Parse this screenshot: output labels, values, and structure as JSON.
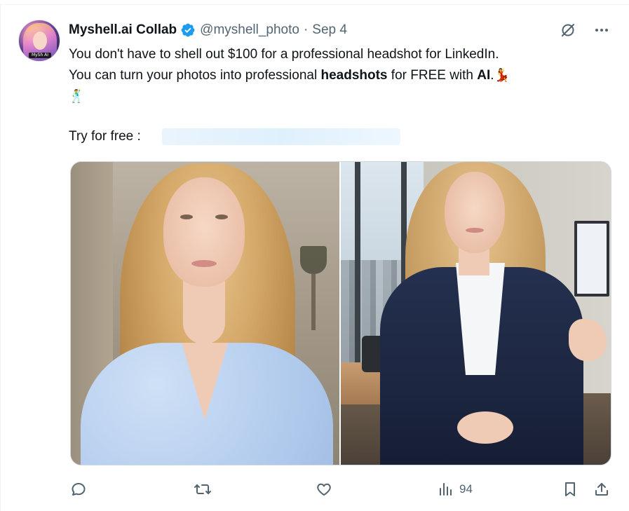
{
  "tweet": {
    "display_name": "Myshell.ai Collab",
    "handle": "@myshell_photo",
    "separator": "·",
    "date": "Sep 4",
    "avatar_label": "MySh AI",
    "text_line1": "You don't have to shell out $100 for a professional headshot for LinkedIn.",
    "text_line2_a": "You can turn your photos into professional ",
    "text_line2_b": "headshots",
    "text_line2_c": " for FREE with ",
    "text_line2_d": "AI",
    "text_line2_e": ".",
    "emoji_1": "💃",
    "emoji_2": "🕺",
    "try_label": "Try for free :"
  },
  "icons": {
    "verified": "verified-badge-icon",
    "grok": "grok-icon",
    "more": "more-icon",
    "reply": "reply-icon",
    "retweet": "retweet-icon",
    "like": "like-icon",
    "views": "views-icon",
    "bookmark": "bookmark-icon",
    "share": "share-icon"
  },
  "media": {
    "left_photo": "casual-portrait-photo",
    "right_photo": "professional-headshot-photo"
  },
  "metrics": {
    "views": "94"
  },
  "colors": {
    "verified_blue": "#1d9bf0",
    "secondary_text": "#536471",
    "primary_text": "#0f1419"
  }
}
